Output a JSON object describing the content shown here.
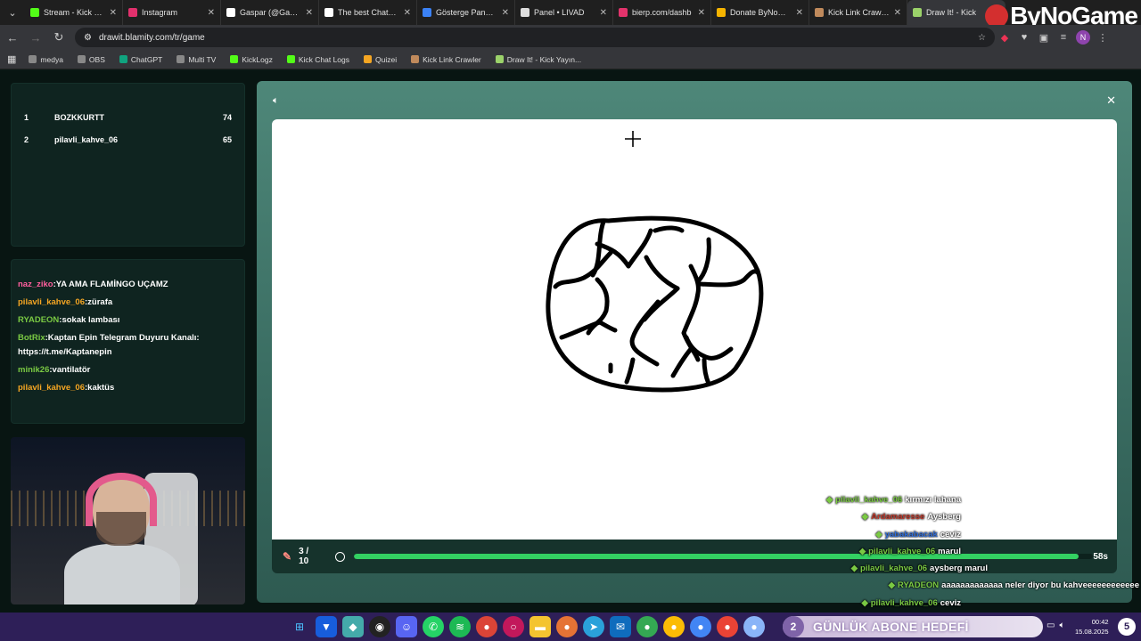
{
  "browser": {
    "tabs": [
      {
        "title": "Stream - Kick Dash",
        "color": "#53fc18"
      },
      {
        "title": "Instagram",
        "color": "#e1306c"
      },
      {
        "title": "Gaspar (@Gaspar",
        "color": "#ffffff"
      },
      {
        "title": "The best ChatBot",
        "color": "#ffffff"
      },
      {
        "title": "Gösterge Paneli -",
        "color": "#3b82f6"
      },
      {
        "title": "Panel • LIVAD",
        "color": "#dddddd"
      },
      {
        "title": "bierp.com/dashb",
        "color": "#e2336b"
      },
      {
        "title": "Donate ByNoGam",
        "color": "#f5b400"
      },
      {
        "title": "Kick Link Crawler",
        "color": "#c08a5c"
      },
      {
        "title": "Draw It! - Kick",
        "color": "#9bd26a"
      }
    ],
    "url": "drawit.blamity.com/tr/game",
    "bookmarks": [
      "medya",
      "OBS",
      "ChatGPT",
      "Multi TV",
      "KickLogz",
      "Kick Chat Logs",
      "Quizei",
      "Kick Link Crawler",
      "Draw It! - Kick Yayın..."
    ],
    "brand": "ByNoGame",
    "profile_initial": "N"
  },
  "scoreboard": [
    {
      "rank": "1",
      "name": "BOZKKURTT",
      "score": "74"
    },
    {
      "rank": "2",
      "name": "pilavli_kahve_06",
      "score": "65"
    }
  ],
  "chat": [
    {
      "user": "naz_ziko",
      "color": "#ff5f9e",
      "text": ":YA AMA FLAMİNGO UÇAMZ"
    },
    {
      "user": "pilavli_kahve_06",
      "color": "#f5a623",
      "text": ":zürafa"
    },
    {
      "user": "RYADEON",
      "color": "#7ac943",
      "text": ":sokak lambası"
    },
    {
      "user": "BotRix",
      "color": "#7ac943",
      "text": ":Kaptan Epin Telegram Duyuru Kanalı: https://t.me/Kaptanepin"
    },
    {
      "user": "minik26",
      "color": "#7ac943",
      "text": ":vantilatör"
    },
    {
      "user": "pilavli_kahve_06",
      "color": "#f5a623",
      "text": ":kaktüs"
    }
  ],
  "game": {
    "round": "3 / 10",
    "progress": 0.98,
    "seconds": "58s"
  },
  "overlay_chat": [
    {
      "user": "pilavli_kahve_06",
      "cls": "u",
      "text": "kırmızı lahana",
      "pad": "202px"
    },
    {
      "user": "Ardamaresse",
      "cls": "u red",
      "text": "Aysberg",
      "pad": "202px"
    },
    {
      "user": "yabakabacak",
      "cls": "u blue",
      "text": "ceviz",
      "pad": "202px"
    },
    {
      "user": "pilavli_kahve_06",
      "cls": "u",
      "text": "marul",
      "pad": "202px"
    },
    {
      "user": "pilavli_kahve_06",
      "cls": "u",
      "text": "aysberg marul",
      "pad": "172px"
    },
    {
      "user": "RYADEON",
      "cls": "u",
      "text": "aaaaaaaaaaaaa neler diyor bu kahveeeeeeeeeeee",
      "pad": "2px"
    },
    {
      "user": "pilavli_kahve_06",
      "cls": "u",
      "text": "ceviz",
      "pad": "202px"
    }
  ],
  "taskbar": {
    "goal_count": "2",
    "goal_label": "GÜNLÜK ABONE HEDEFİ",
    "time": "00:42",
    "date": "15.08.2025",
    "badge": "5"
  }
}
